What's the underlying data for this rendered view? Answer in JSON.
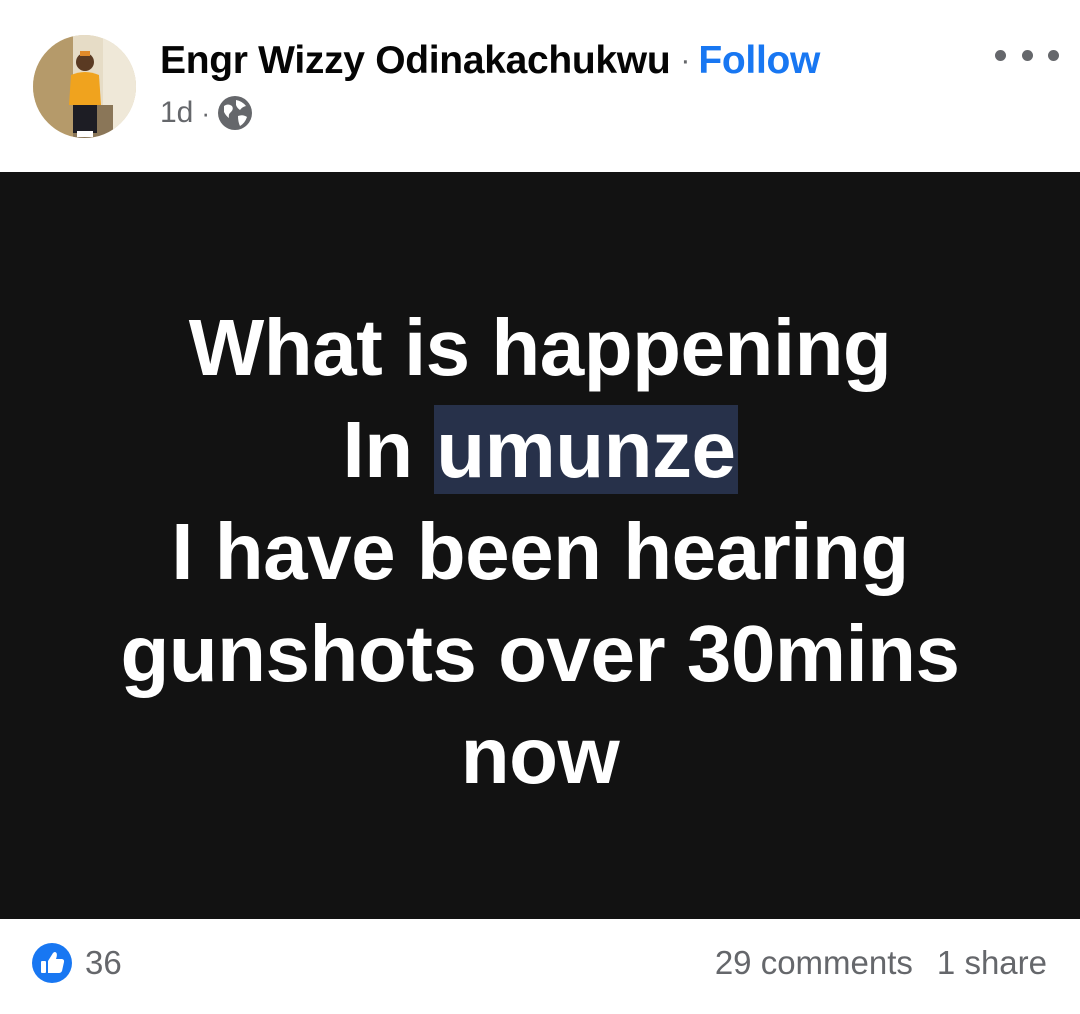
{
  "post": {
    "author_name": "Engr Wizzy Odinakachukwu",
    "separator": "·",
    "follow_label": "Follow",
    "timestamp": "1d",
    "meta_separator": "·",
    "privacy_icon": "globe-icon",
    "more_icon": "more-options-icon"
  },
  "content": {
    "background_color": "#121212",
    "text_color": "#ffffff",
    "highlight_color": "#27314a",
    "line1": "What is happening",
    "line2_prefix": "In",
    "line2_highlight": "umunze",
    "line3": "I have been hearing",
    "line4": "gunshots over 30mins",
    "line5": "now"
  },
  "footer": {
    "reaction_icon": "like-icon",
    "reaction_color": "#1877f2",
    "reaction_count": "36",
    "comments_label": "29 comments",
    "shares_label": "1 share"
  },
  "colors": {
    "accent": "#1877f2",
    "secondary_text": "#65676b",
    "primary_text": "#050505"
  }
}
